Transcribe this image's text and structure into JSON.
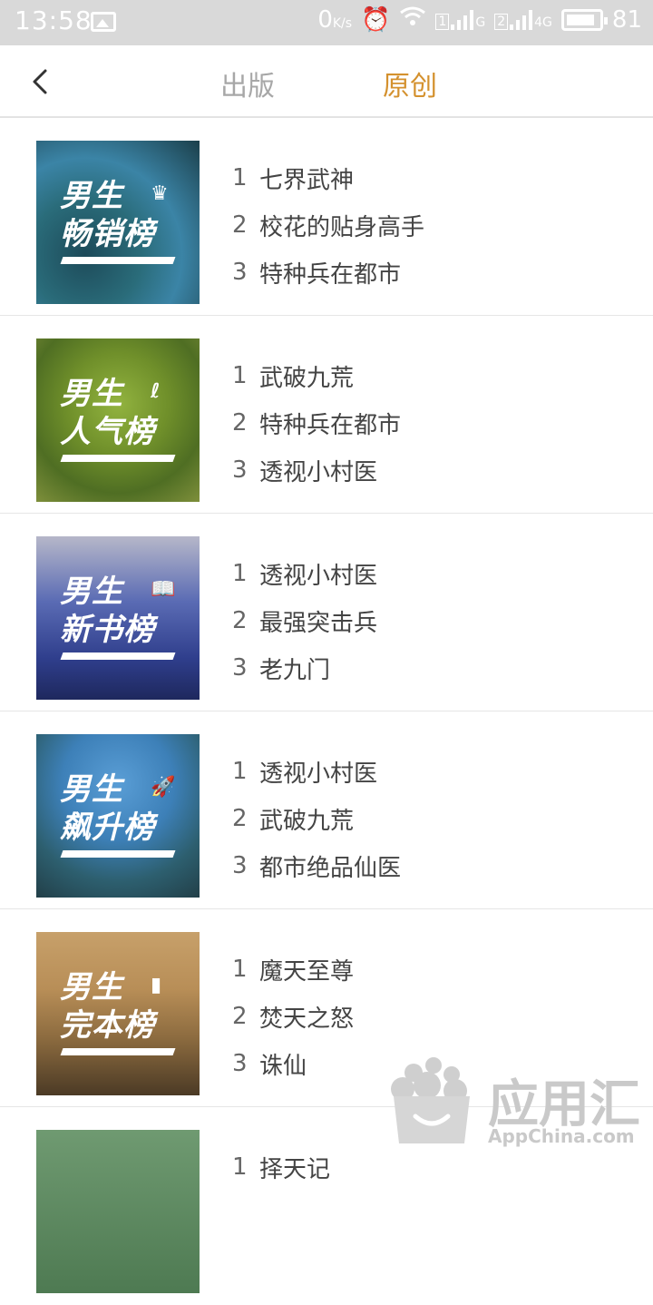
{
  "status_bar": {
    "time": "13:58",
    "speed": "0",
    "speed_unit": "K/s",
    "battery": "81",
    "sim1": "1",
    "sim1_net": "G",
    "sim2": "2",
    "sim2_net": "4G"
  },
  "header": {
    "tab_publish": "出版",
    "tab_original": "原创"
  },
  "boards": [
    {
      "cover_line1": "男生",
      "cover_line2": "畅销榜",
      "badge": "♛",
      "items": [
        {
          "rank": "1",
          "title": "七界武神"
        },
        {
          "rank": "2",
          "title": "校花的贴身高手"
        },
        {
          "rank": "3",
          "title": "特种兵在都市"
        }
      ]
    },
    {
      "cover_line1": "男生",
      "cover_line2": "人气榜",
      "badge": "ℓ",
      "items": [
        {
          "rank": "1",
          "title": "武破九荒"
        },
        {
          "rank": "2",
          "title": "特种兵在都市"
        },
        {
          "rank": "3",
          "title": "透视小村医"
        }
      ]
    },
    {
      "cover_line1": "男生",
      "cover_line2": "新书榜",
      "badge": "📖",
      "items": [
        {
          "rank": "1",
          "title": "透视小村医"
        },
        {
          "rank": "2",
          "title": "最强突击兵"
        },
        {
          "rank": "3",
          "title": "老九门"
        }
      ]
    },
    {
      "cover_line1": "男生",
      "cover_line2": "飙升榜",
      "badge": "🚀",
      "items": [
        {
          "rank": "1",
          "title": "透视小村医"
        },
        {
          "rank": "2",
          "title": "武破九荒"
        },
        {
          "rank": "3",
          "title": "都市绝品仙医"
        }
      ]
    },
    {
      "cover_line1": "男生",
      "cover_line2": "完本榜",
      "badge": "▮",
      "items": [
        {
          "rank": "1",
          "title": "魔天至尊"
        },
        {
          "rank": "2",
          "title": "焚天之怒"
        },
        {
          "rank": "3",
          "title": "诛仙"
        }
      ]
    },
    {
      "items": [
        {
          "rank": "1",
          "title": "择天记"
        }
      ]
    }
  ],
  "watermark": {
    "text": "应用汇",
    "subtext": "AppChina.com"
  }
}
